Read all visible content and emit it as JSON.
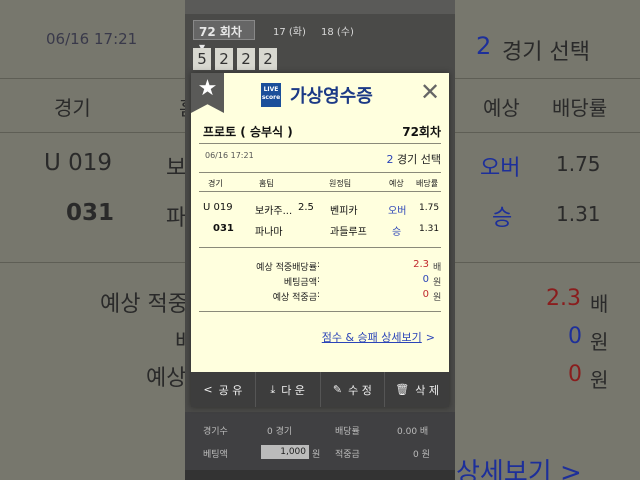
{
  "background": {
    "datetime": "06/16  17:21",
    "selection_count": "2",
    "selection_label": "경기 선택",
    "headers": {
      "game": "경기",
      "home": "홈",
      "forecast": "예상",
      "odds": "배당률"
    },
    "rows": [
      {
        "id": "U 019",
        "home": "보",
        "forecast": "오버",
        "odds": "1.75"
      },
      {
        "id": "031",
        "home": "파",
        "forecast": "승",
        "odds": "1.31"
      }
    ],
    "sum_labels": {
      "odds": "예상 적중",
      "bet": "배",
      "win": "예상"
    },
    "sum_odds_value": "2.3",
    "sum_odds_unit": "배",
    "sum_bet_value": "0",
    "sum_bet_unit": "원",
    "sum_win_value": "0",
    "sum_win_unit": "원",
    "link": "상세보기 >"
  },
  "phone": {
    "round_select": "72 회차 ▾",
    "round_tabs": [
      "17 (화)",
      "18 (수)"
    ],
    "digits": [
      "5",
      "2",
      "2",
      "2"
    ],
    "bottom": {
      "games_label": "경기수",
      "games_value": "0 경기",
      "odds_label": "배당률",
      "odds_value": "0.00 배",
      "bet_label": "베팅액",
      "bet_value": "1,000",
      "bet_unit": "원",
      "win_label": "적중금",
      "win_value": "0 원"
    }
  },
  "modal": {
    "star_icon": "★",
    "logo_text": "LIVE score",
    "title": "가상영수증",
    "close_icon": "✕",
    "receipt_type": "프로토 ( 승부식 )",
    "round": "72회차",
    "datetime": "06/16  17:21",
    "selection_count": "2",
    "selection_label": "경기 선택",
    "columns": {
      "game": "경기",
      "home": "홈팀",
      "away": "원정팀",
      "forecast": "예상",
      "odds": "배당률"
    },
    "rows": [
      {
        "id": "U 019",
        "home": "보카주...",
        "handicap": "2.5",
        "away": "벤피카",
        "forecast": "오버",
        "odds": "1.75"
      },
      {
        "id": "031",
        "home": "파나마",
        "handicap": "",
        "away": "과들루프",
        "forecast": "승",
        "odds": "1.31"
      }
    ],
    "summary": [
      {
        "label": "예상 적중배당률",
        "value": "2.3",
        "unit": "배"
      },
      {
        "label": "베팅금액",
        "value": "0",
        "unit": "원"
      },
      {
        "label": "예상 적중금",
        "value": "0",
        "unit": "원"
      }
    ],
    "colon": ":",
    "detail_link": "점수 & 승패 상세보기",
    "detail_arrow": ">",
    "actions": [
      {
        "icon": "share-icon",
        "glyph": "<",
        "label": "공 유"
      },
      {
        "icon": "download-icon",
        "glyph": "⤓",
        "label": "다 운"
      },
      {
        "icon": "edit-icon",
        "glyph": "✎",
        "label": "수 정"
      },
      {
        "icon": "trash-icon",
        "glyph": "🗑",
        "label": "삭 제"
      }
    ]
  },
  "colors": {
    "accent_blue": "#2b44b8",
    "accent_red": "#c0282d",
    "modal_bg": "#ffffde",
    "action_bar": "#3d3d3d"
  }
}
